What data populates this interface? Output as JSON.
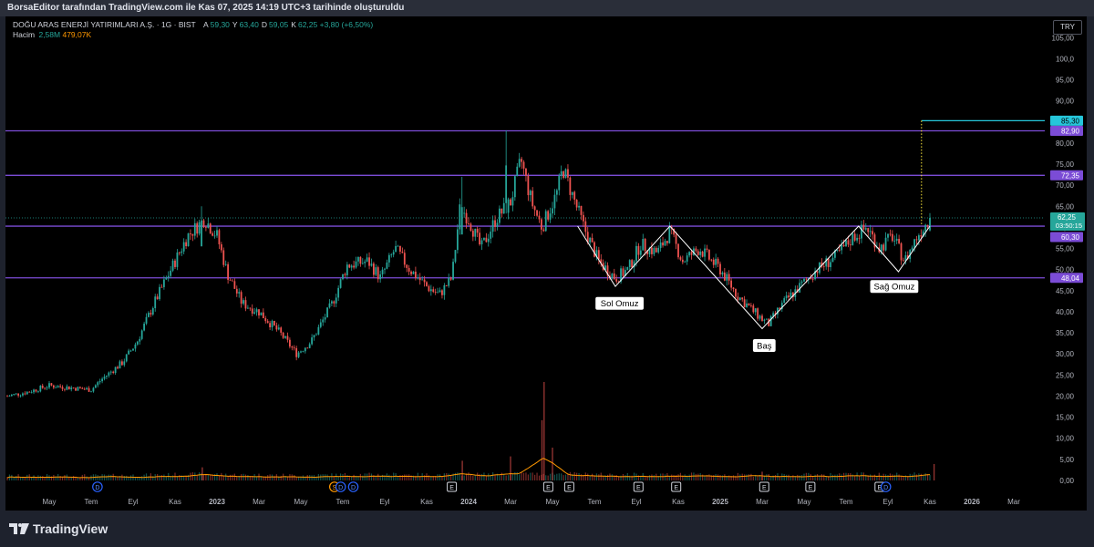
{
  "header": {
    "caption": "BorsaEditor tarafından TradingView.com ile Kas 07, 2025 14:19 UTC+3 tarihinde oluşturuldu"
  },
  "legend": {
    "symbol": "DOĞU ARAS ENERJİ YATIRIMLARI A.Ş. · 1G · BIST",
    "ohlc": [
      {
        "label": "A",
        "value": "59,30"
      },
      {
        "label": "Y",
        "value": "63,40"
      },
      {
        "label": "D",
        "value": "59,05"
      },
      {
        "label": "K",
        "value": "62,25"
      }
    ],
    "change": "+3,80 (+6,50%)",
    "volume_label": "Hacim",
    "volume_value": "2,58M",
    "volume_ma": "479,07K"
  },
  "currency": "TRY",
  "brand": "TradingView",
  "colors": {
    "up": "#26a69a",
    "down": "#ef5350",
    "level": "#7b4cd6",
    "target": "#26c6da",
    "volume_ma": "#ff9800",
    "pattern": "#ffffff",
    "dotted": "#ffeb3b",
    "bg": "#000000"
  },
  "chart_data": {
    "type": "candlestick",
    "title": "DOĞU ARAS ENERJİ YATIRIMLARI A.Ş.",
    "timeframe": "1G",
    "y_range": [
      0,
      107
    ],
    "y_ticks": [
      "105,00",
      "100,0",
      "95,00",
      "90,00",
      "85,00",
      "80,00",
      "75,00",
      "70,00",
      "65,00",
      "60,00",
      "55,00",
      "50,00",
      "45,00",
      "40,00",
      "35,00",
      "30,00",
      "25,00",
      "20,00",
      "15,00",
      "10,00",
      "5,00",
      "0,00"
    ],
    "y_tick_values": [
      105,
      100,
      95,
      90,
      85,
      80,
      75,
      70,
      65,
      60,
      55,
      50,
      45,
      40,
      35,
      30,
      25,
      20,
      15,
      10,
      5,
      0
    ],
    "x_ticks": [
      {
        "label": "May",
        "t": 0.2,
        "bold": false
      },
      {
        "label": "Tem",
        "t": 0.4,
        "bold": false
      },
      {
        "label": "Eyl",
        "t": 0.6,
        "bold": false
      },
      {
        "label": "Kas",
        "t": 0.8,
        "bold": false
      },
      {
        "label": "2023",
        "t": 1.0,
        "bold": true
      },
      {
        "label": "Mar",
        "t": 1.2,
        "bold": false
      },
      {
        "label": "May",
        "t": 1.4,
        "bold": false
      },
      {
        "label": "Tem",
        "t": 1.6,
        "bold": false
      },
      {
        "label": "Eyl",
        "t": 1.8,
        "bold": false
      },
      {
        "label": "Kas",
        "t": 2.0,
        "bold": false
      },
      {
        "label": "2024",
        "t": 2.2,
        "bold": true
      },
      {
        "label": "Mar",
        "t": 2.4,
        "bold": false
      },
      {
        "label": "May",
        "t": 2.6,
        "bold": false
      },
      {
        "label": "Tem",
        "t": 2.8,
        "bold": false
      },
      {
        "label": "Eyl",
        "t": 3.0,
        "bold": false
      },
      {
        "label": "Kas",
        "t": 3.2,
        "bold": false
      },
      {
        "label": "2025",
        "t": 3.4,
        "bold": true
      },
      {
        "label": "Mar",
        "t": 3.6,
        "bold": false
      },
      {
        "label": "May",
        "t": 3.8,
        "bold": false
      },
      {
        "label": "Tem",
        "t": 4.0,
        "bold": false
      },
      {
        "label": "Eyl",
        "t": 4.2,
        "bold": false
      },
      {
        "label": "Kas",
        "t": 4.4,
        "bold": false
      },
      {
        "label": "2026",
        "t": 4.6,
        "bold": true
      },
      {
        "label": "Mar",
        "t": 4.8,
        "bold": false
      }
    ],
    "price_path": [
      {
        "t": 0.0,
        "v": 20
      },
      {
        "t": 0.1,
        "v": 21
      },
      {
        "t": 0.2,
        "v": 22.5
      },
      {
        "t": 0.3,
        "v": 22
      },
      {
        "t": 0.4,
        "v": 21.5
      },
      {
        "t": 0.45,
        "v": 24
      },
      {
        "t": 0.55,
        "v": 28
      },
      {
        "t": 0.62,
        "v": 33
      },
      {
        "t": 0.7,
        "v": 42
      },
      {
        "t": 0.78,
        "v": 50
      },
      {
        "t": 0.86,
        "v": 58
      },
      {
        "t": 0.94,
        "v": 62
      },
      {
        "t": 1.0,
        "v": 58
      },
      {
        "t": 1.05,
        "v": 49
      },
      {
        "t": 1.12,
        "v": 42
      },
      {
        "t": 1.2,
        "v": 40
      },
      {
        "t": 1.3,
        "v": 35
      },
      {
        "t": 1.38,
        "v": 30
      },
      {
        "t": 1.45,
        "v": 33
      },
      {
        "t": 1.55,
        "v": 42
      },
      {
        "t": 1.62,
        "v": 51
      },
      {
        "t": 1.72,
        "v": 52
      },
      {
        "t": 1.78,
        "v": 48
      },
      {
        "t": 1.85,
        "v": 55
      },
      {
        "t": 1.92,
        "v": 50
      },
      {
        "t": 2.0,
        "v": 46
      },
      {
        "t": 2.06,
        "v": 44
      },
      {
        "t": 2.12,
        "v": 48
      },
      {
        "t": 2.16,
        "v": 65
      },
      {
        "t": 2.2,
        "v": 62
      },
      {
        "t": 2.26,
        "v": 55
      },
      {
        "t": 2.33,
        "v": 62
      },
      {
        "t": 2.4,
        "v": 66
      },
      {
        "t": 2.45,
        "v": 76
      },
      {
        "t": 2.5,
        "v": 66
      },
      {
        "t": 2.55,
        "v": 60
      },
      {
        "t": 2.62,
        "v": 68
      },
      {
        "t": 2.65,
        "v": 74
      },
      {
        "t": 2.7,
        "v": 67
      },
      {
        "t": 2.75,
        "v": 60
      },
      {
        "t": 2.82,
        "v": 52
      },
      {
        "t": 2.9,
        "v": 48
      },
      {
        "t": 2.96,
        "v": 50
      },
      {
        "t": 3.02,
        "v": 56
      },
      {
        "t": 3.1,
        "v": 54
      },
      {
        "t": 3.16,
        "v": 59
      },
      {
        "t": 3.22,
        "v": 52
      },
      {
        "t": 3.3,
        "v": 55
      },
      {
        "t": 3.4,
        "v": 50
      },
      {
        "t": 3.48,
        "v": 44
      },
      {
        "t": 3.56,
        "v": 40
      },
      {
        "t": 3.63,
        "v": 37
      },
      {
        "t": 3.7,
        "v": 42
      },
      {
        "t": 3.78,
        "v": 46
      },
      {
        "t": 3.86,
        "v": 50
      },
      {
        "t": 3.95,
        "v": 53
      },
      {
        "t": 4.04,
        "v": 58
      },
      {
        "t": 4.1,
        "v": 60
      },
      {
        "t": 4.16,
        "v": 55
      },
      {
        "t": 4.22,
        "v": 58
      },
      {
        "t": 4.28,
        "v": 52
      },
      {
        "t": 4.34,
        "v": 58
      },
      {
        "t": 4.4,
        "v": 62.25
      }
    ],
    "spikes": [
      {
        "t": 2.38,
        "high": 83
      },
      {
        "t": 0.93,
        "high": 65
      },
      {
        "t": 2.17,
        "high": 72
      },
      {
        "t": 4.42,
        "high": 63.4
      }
    ],
    "volume_spikes": [
      {
        "t": 2.56,
        "h": 0.9
      },
      {
        "t": 2.55,
        "h": 0.55
      },
      {
        "t": 2.6,
        "h": 0.3
      },
      {
        "t": 2.4,
        "h": 0.22
      },
      {
        "t": 2.17,
        "h": 0.18
      },
      {
        "t": 0.93,
        "h": 0.12
      },
      {
        "t": 3.6,
        "h": 0.08
      },
      {
        "t": 4.42,
        "h": 0.15
      }
    ],
    "horizontal_levels": [
      {
        "value": 82.9,
        "label": "82,90"
      },
      {
        "value": 72.35,
        "label": "72,35"
      },
      {
        "value": 60.3,
        "label": "60,30"
      },
      {
        "value": 48.04,
        "label": "48,04"
      }
    ],
    "target_line": {
      "value": 85.3,
      "label": "85,30",
      "t_start": 4.36
    },
    "last_price": {
      "value": 62.25,
      "label": "62,25",
      "countdown": "03:50:15"
    },
    "pattern": {
      "name": "head-and-shoulders",
      "points": [
        {
          "t": 2.72,
          "v": 60.3
        },
        {
          "t": 2.9,
          "v": 46
        },
        {
          "t": 3.16,
          "v": 60.3
        },
        {
          "t": 3.6,
          "v": 36
        },
        {
          "t": 4.06,
          "v": 60.3
        },
        {
          "t": 4.25,
          "v": 49.5
        },
        {
          "t": 4.4,
          "v": 60.3
        }
      ],
      "labels": [
        {
          "text": "Sol Omuz",
          "t": 2.92,
          "v": 42
        },
        {
          "text": "Baş",
          "t": 3.61,
          "v": 32
        },
        {
          "text": "Sağ Omuz",
          "t": 4.23,
          "v": 46
        }
      ]
    },
    "events": [
      {
        "t": 0.43,
        "text": "D",
        "kind": "dividend"
      },
      {
        "t": 1.56,
        "text": "S",
        "kind": "split"
      },
      {
        "t": 1.59,
        "text": "D",
        "kind": "dividend"
      },
      {
        "t": 1.65,
        "text": "D",
        "kind": "dividend"
      },
      {
        "t": 2.12,
        "text": "E",
        "kind": "earnings"
      },
      {
        "t": 2.58,
        "text": "E",
        "kind": "earnings"
      },
      {
        "t": 2.68,
        "text": "E",
        "kind": "earnings"
      },
      {
        "t": 3.01,
        "text": "E",
        "kind": "earnings"
      },
      {
        "t": 3.19,
        "text": "E",
        "kind": "earnings"
      },
      {
        "t": 3.61,
        "text": "E",
        "kind": "earnings"
      },
      {
        "t": 3.83,
        "text": "E",
        "kind": "earnings"
      },
      {
        "t": 4.16,
        "text": "E",
        "kind": "earnings"
      },
      {
        "t": 4.19,
        "text": "D",
        "kind": "dividend"
      }
    ]
  }
}
